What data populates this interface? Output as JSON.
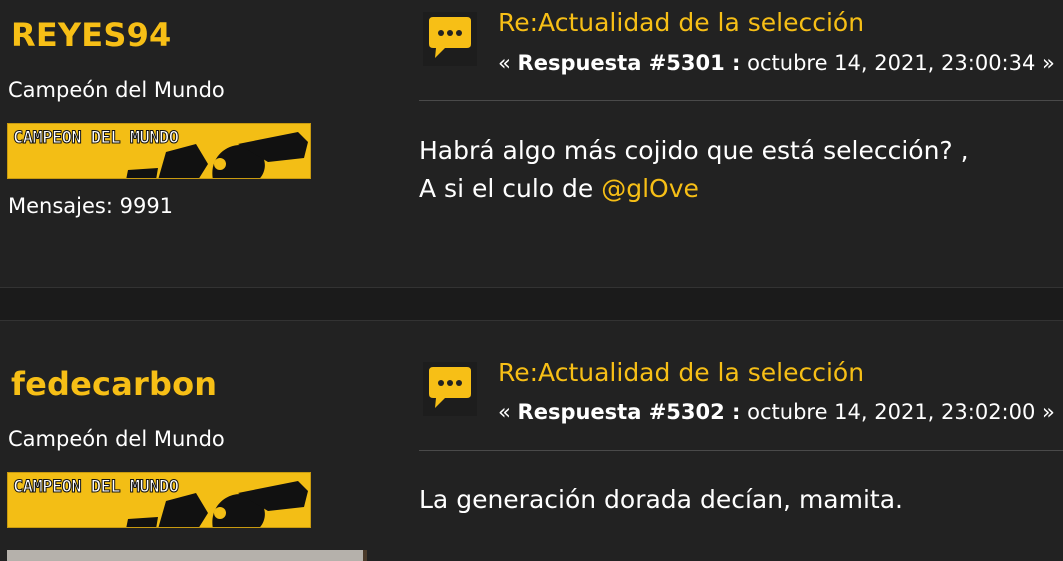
{
  "posts": [
    {
      "username": "REYES94",
      "rank_title": "Campeón del Mundo",
      "badge_text": "CAMPEON DEL MUNDO",
      "post_count": "Mensajes: 9991",
      "subject": "Re:Actualidad de la selección",
      "reply_prefix": "« ",
      "reply_label": "Respuesta #5301 :",
      "reply_date": " octubre 14, 2021, 23:00:34 »",
      "body_line1": "Habrá algo más cojido que está selección? ,",
      "body_line2_prefix": "A si el culo de ",
      "body_mention": "@glOve",
      "icon": "speech-bubble-icon"
    },
    {
      "username": "fedecarbon",
      "rank_title": "Campeón del Mundo",
      "badge_text": "CAMPEON DEL MUNDO",
      "subject": "Re:Actualidad de la selección",
      "reply_prefix": "« ",
      "reply_label": "Respuesta #5302 :",
      "reply_date": " octubre 14, 2021, 23:02:00 »",
      "body_line1": "La generación dorada decían, mamita.",
      "icon": "speech-bubble-icon"
    }
  ],
  "colors": {
    "accent": "#f7bf16",
    "background": "#222222",
    "text": "#ffffff"
  }
}
